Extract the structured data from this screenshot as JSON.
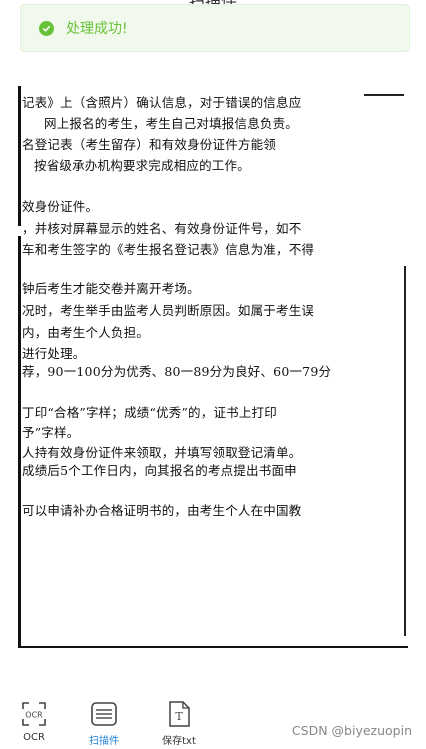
{
  "header": {
    "title": "扫描件"
  },
  "toast": {
    "message": "处理成功!"
  },
  "document": {
    "lines": [
      "记表》上（含照片）确认信息，对于错误的信息应",
      "网上报名的考生，考生自己对填报信息负责。",
      "名登记表（考生留存）和有效身份证件方能领",
      "按省级承办机构要求完成相应的工作。",
      "效身份证件。",
      "，并核对屏幕显示的姓名、有效身份证件号，如不",
      "车和考生签字的《考生报名登记表》信息为准，不得",
      "钟后考生才能交卷并离开考场。",
      "况时，考生举手由监考人员判断原因。如属于考生误",
      "内，由考生个人负担。",
      "进行处理。",
      "荐，90一100分为优秀、80一89分为良好、60一79分",
      "丁印“合格”字样；成绩“优秀”的，证书上打印",
      "予”字样。",
      "人持有效身份证件来领取，并填写领取登记清单。",
      "成绩后5个工作日内，向其报名的考点提出书面申",
      "可以申请补办合格证明书的，由考生个人在中国教"
    ]
  },
  "tabs": [
    {
      "label": "OCR",
      "icon_text": "OCR"
    },
    {
      "label": "扫描件"
    },
    {
      "label": "保存txt",
      "icon_text": "T"
    }
  ],
  "watermark": "CSDN @biyezuopin",
  "colors": {
    "success": "#67c23a",
    "active": "#1e7fd6"
  }
}
